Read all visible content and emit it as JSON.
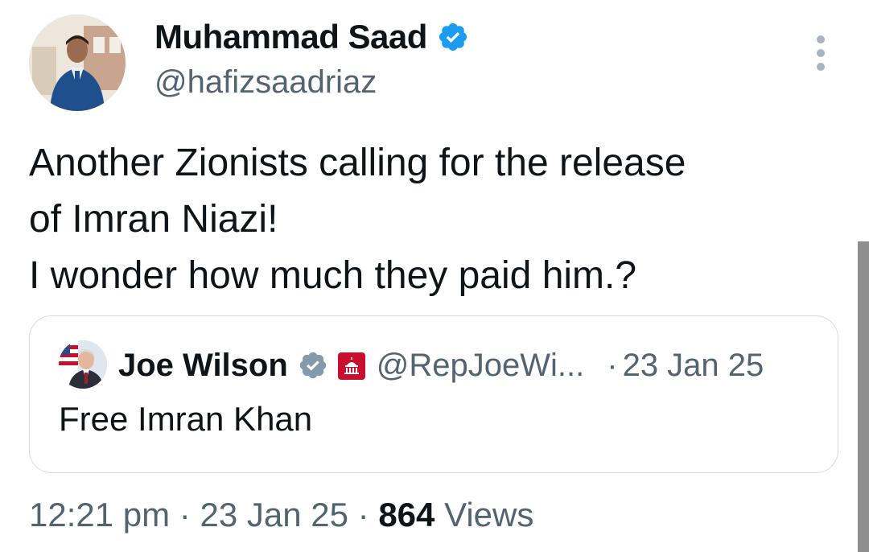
{
  "author": {
    "name": "Muhammad Saad",
    "handle": "@hafizsaadriaz"
  },
  "tweet": {
    "lines": [
      "Another Zionists calling for the release",
      "of Imran Niazi!",
      "I wonder how much they paid him.?"
    ]
  },
  "quote": {
    "name": "Joe Wilson",
    "handle": "@RepJoeWi...",
    "separator": "·",
    "date": "23 Jan 25",
    "text": "Free Imran Khan"
  },
  "meta": {
    "time": "12:21 pm",
    "sep1": "·",
    "date": "23 Jan 25",
    "sep2": "·",
    "views_count": "864",
    "views_label": "Views"
  },
  "icons": {
    "verified": "verified-badge-icon",
    "government": "government-badge-icon",
    "more": "more-options-icon"
  },
  "colors": {
    "verified_blue": "#1d9bf0",
    "verified_gray": "#829aab",
    "government_red": "#c8102e",
    "secondary_text": "#536471",
    "primary_text": "#0f1419"
  }
}
